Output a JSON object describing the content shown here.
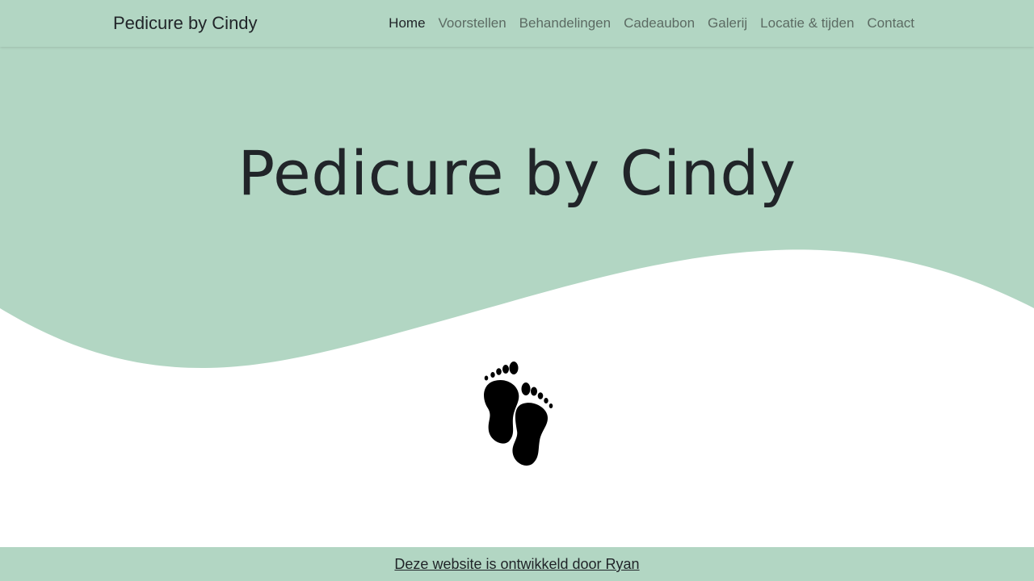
{
  "nav": {
    "brand": "Pedicure by Cindy",
    "items": [
      {
        "label": "Home",
        "active": true
      },
      {
        "label": "Voorstellen",
        "active": false
      },
      {
        "label": "Behandelingen",
        "active": false
      },
      {
        "label": "Cadeaubon",
        "active": false
      },
      {
        "label": "Galerij",
        "active": false
      },
      {
        "label": "Locatie & tijden",
        "active": false
      },
      {
        "label": "Contact",
        "active": false
      }
    ]
  },
  "hero": {
    "title": "Pedicure by Cindy",
    "background_color": "#b2d6c3"
  },
  "main": {
    "icon": "footprints-icon"
  },
  "footer": {
    "credit_link": "Deze website is ontwikkeld door Ryan"
  },
  "colors": {
    "accent": "#b2d6c3",
    "text": "#212529",
    "nav_text": "#5c6b63"
  }
}
